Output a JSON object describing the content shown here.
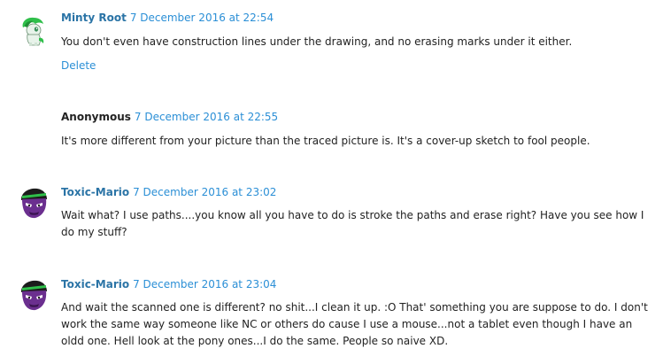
{
  "comments": [
    {
      "author": "Minty Root",
      "timestamp": "7 December 2016 at 22:54",
      "text": "You don't even have construction lines under the drawing, and no erasing marks under it either.",
      "delete_label": "Delete",
      "avatar": "green-pony-avatar"
    },
    {
      "author": "Anonymous",
      "timestamp": "7 December 2016 at 22:55",
      "text": "It's more different from your picture than the traced picture is. It's a cover-up sketch to fool people."
    },
    {
      "author": "Toxic-Mario",
      "timestamp": "7 December 2016 at 23:02",
      "text": "Wait what? I use paths....you know all you have to do is stroke the paths and erase right? Have you see how I do my stuff?",
      "avatar": "purple-character-avatar"
    },
    {
      "author": "Toxic-Mario",
      "timestamp": "7 December 2016 at 23:04",
      "text": "And wait the scanned one is different? no shit...I clean it up. :O That' something you are suppose to do. I don't work the same way someone like NC or others do cause I use a mouse...not a tablet even though I have an oldd one. Hell look at the pony ones...I do the same. People so naive XD.",
      "avatar": "purple-character-avatar"
    }
  ],
  "colors": {
    "author_link": "#2b74a6",
    "timestamp_link": "#2b8fd6",
    "text": "#222222"
  }
}
